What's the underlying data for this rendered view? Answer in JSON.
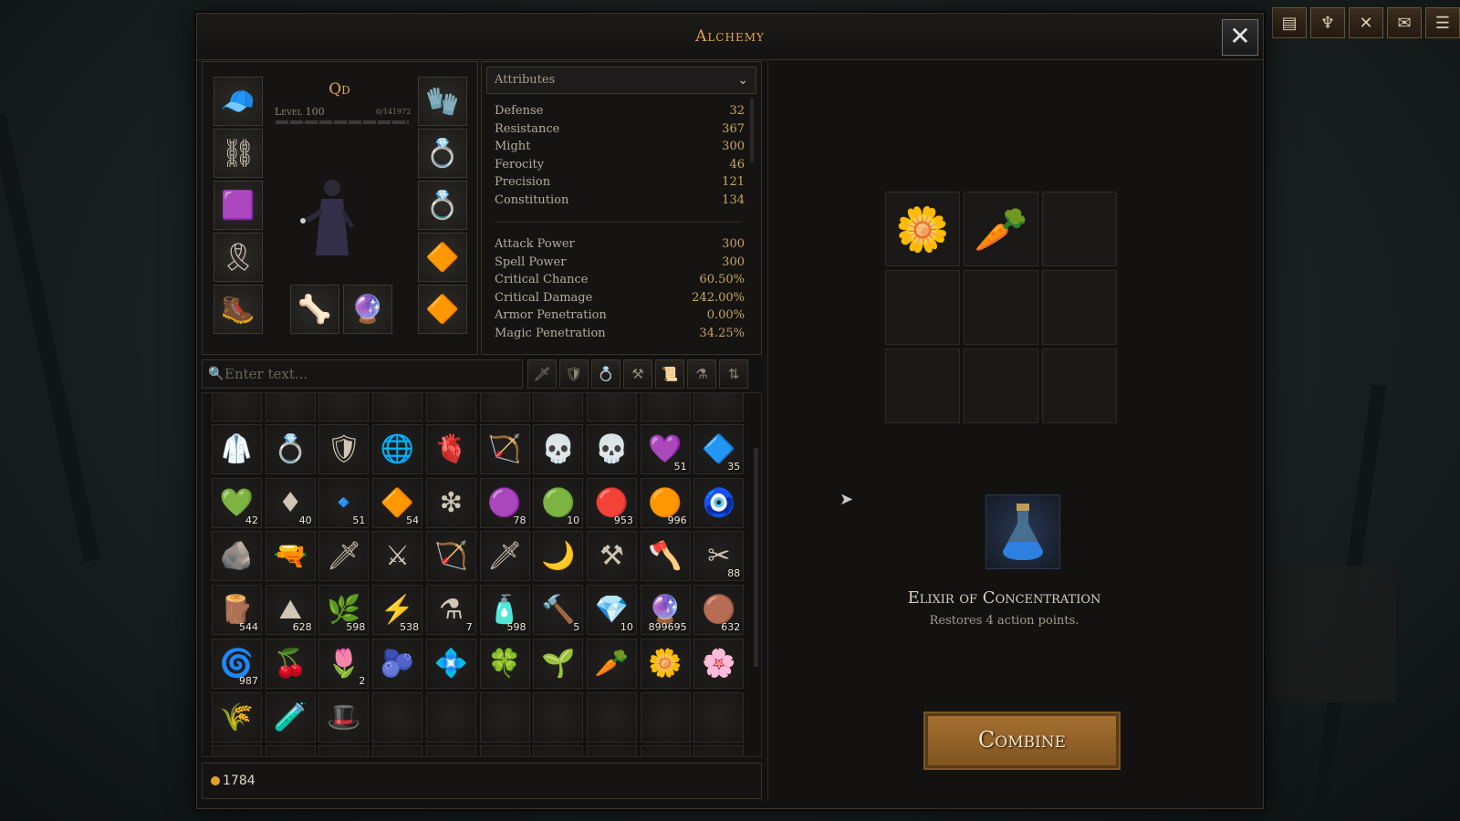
{
  "window": {
    "title": "Alchemy",
    "close_label": "✕"
  },
  "topbar": [
    {
      "icon": "journal-icon",
      "glyph": "▤"
    },
    {
      "icon": "trophy-icon",
      "glyph": "♆"
    },
    {
      "icon": "crossed-swords-icon",
      "glyph": "✕"
    },
    {
      "icon": "mail-icon",
      "glyph": "✉"
    },
    {
      "icon": "menu-icon",
      "glyph": "☰"
    }
  ],
  "character": {
    "name": "Qd",
    "level": "Level 100",
    "xp": "0/141972"
  },
  "attributes": {
    "dropdown": "Attributes",
    "primary": [
      {
        "name": "Defense",
        "value": "32"
      },
      {
        "name": "Resistance",
        "value": "367"
      },
      {
        "name": "Might",
        "value": "300"
      },
      {
        "name": "Ferocity",
        "value": "46"
      },
      {
        "name": "Precision",
        "value": "121"
      },
      {
        "name": "Constitution",
        "value": "134"
      }
    ],
    "secondary": [
      {
        "name": "Attack Power",
        "value": "300"
      },
      {
        "name": "Spell Power",
        "value": "300"
      },
      {
        "name": "Critical Chance",
        "value": "60.50%"
      },
      {
        "name": "Critical Damage",
        "value": "242.00%"
      },
      {
        "name": "Armor Penetration",
        "value": "0.00%"
      },
      {
        "name": "Magic Penetration",
        "value": "34.25%"
      }
    ]
  },
  "search": {
    "placeholder": "Enter text..."
  },
  "inventory": {
    "rows": [
      [
        {
          "g": "🥼"
        },
        {
          "g": "💍"
        },
        {
          "g": "🛡"
        },
        {
          "g": "🌐"
        },
        {
          "g": "🫀"
        },
        {
          "g": "🏹"
        },
        {
          "g": "💀"
        },
        {
          "g": "💀"
        },
        {
          "g": "💜",
          "q": "51"
        },
        {
          "g": "🔷",
          "q": "35"
        }
      ],
      [
        {
          "g": "💚",
          "q": "42"
        },
        {
          "g": "♦",
          "q": "40"
        },
        {
          "g": "🔹",
          "q": "51"
        },
        {
          "g": "🔶",
          "q": "54"
        },
        {
          "g": "❇"
        },
        {
          "g": "🟣",
          "q": "78"
        },
        {
          "g": "🟢",
          "q": "10"
        },
        {
          "g": "🔴",
          "q": "953"
        },
        {
          "g": "🟠",
          "q": "996"
        },
        {
          "g": "🧿"
        }
      ],
      [
        {
          "g": "🪨"
        },
        {
          "g": "🔫"
        },
        {
          "g": "🗡"
        },
        {
          "g": "⚔"
        },
        {
          "g": "🏹"
        },
        {
          "g": "🗡"
        },
        {
          "g": "🌙"
        },
        {
          "g": "⚒"
        },
        {
          "g": "🪓"
        },
        {
          "g": "✂",
          "q": "88"
        }
      ],
      [
        {
          "g": "🪵",
          "q": "544"
        },
        {
          "g": "⛰",
          "q": "628"
        },
        {
          "g": "🌿",
          "q": "598"
        },
        {
          "g": "⚡",
          "q": "538"
        },
        {
          "g": "⚗",
          "q": "7"
        },
        {
          "g": "🧴",
          "q": "598"
        },
        {
          "g": "🔨",
          "q": "5"
        },
        {
          "g": "💎",
          "q": "10"
        },
        {
          "g": "🔮",
          "q": "899695"
        },
        {
          "g": "🟤",
          "q": "632"
        }
      ],
      [
        {
          "g": "🌀",
          "q": "987"
        },
        {
          "g": "🍒"
        },
        {
          "g": "🌷",
          "q": "2"
        },
        {
          "g": "🫐"
        },
        {
          "g": "💠"
        },
        {
          "g": "🍀"
        },
        {
          "g": "🌱"
        },
        {
          "g": "🥕"
        },
        {
          "g": "🌼"
        },
        {
          "g": "🌸"
        }
      ],
      [
        {
          "g": "🌾"
        },
        {
          "g": "🧪"
        },
        {
          "g": "🎩"
        },
        {
          "g": ""
        },
        {
          "g": ""
        },
        {
          "g": ""
        },
        {
          "g": ""
        },
        {
          "g": ""
        },
        {
          "g": ""
        },
        {
          "g": ""
        }
      ]
    ]
  },
  "gold": "1784",
  "recipe": {
    "ingredients": [
      "🌼",
      "🥕",
      "",
      "",
      "",
      "",
      "",
      "",
      ""
    ]
  },
  "result": {
    "name": "Elixir of Concentration",
    "description": "Restores 4 action points.",
    "icon": "blue-potion-icon"
  },
  "combine_label": "Combine"
}
